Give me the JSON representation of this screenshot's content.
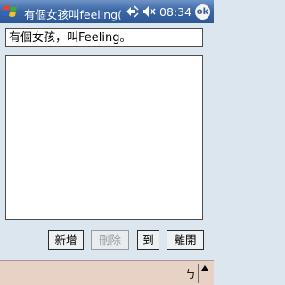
{
  "titlebar": {
    "title": "有個女孩叫feeling(ẟ",
    "time": "08:34",
    "ok_label": "ok",
    "icons": [
      "windows-flag-icon",
      "connectivity-icon",
      "speaker-muted-icon"
    ]
  },
  "form": {
    "subject_value": "有個女孩，叫Feeling。",
    "body_value": ""
  },
  "buttons": {
    "new_label": "新增",
    "delete_label": "刪除",
    "goto_label": "到",
    "leave_label": "離開"
  },
  "bottombar": {
    "sip_label": "ㄅ",
    "sip_menu_icon": "up-arrow-icon"
  }
}
